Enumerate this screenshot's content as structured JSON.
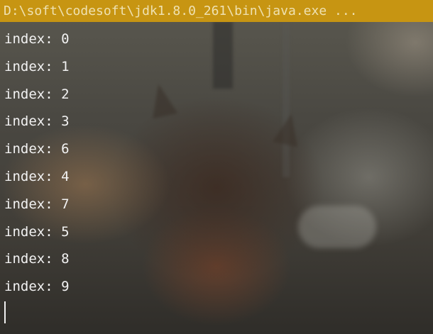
{
  "window": {
    "title": "D:\\soft\\codesoft\\jdk1.8.0_261\\bin\\java.exe ...",
    "title_bar_color": "#c79512"
  },
  "console": {
    "lines": [
      "index: 0",
      "index: 1",
      "index: 2",
      "index: 3",
      "index: 6",
      "index: 4",
      "index: 7",
      "index: 5",
      "index: 8",
      "index: 9"
    ],
    "text_color": "#f2f2f2",
    "cursor": "text-cursor"
  }
}
